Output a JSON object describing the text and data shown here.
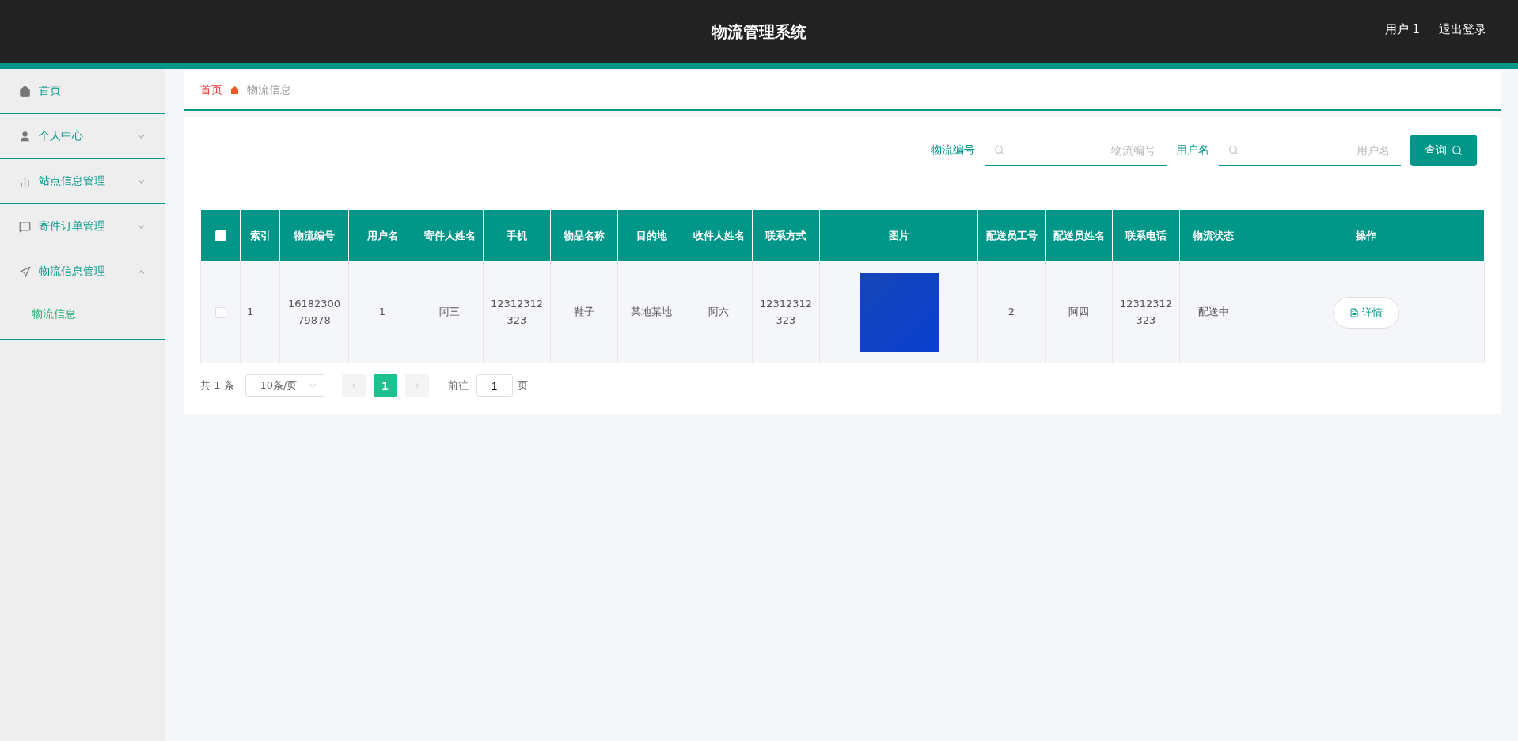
{
  "header": {
    "title": "物流管理系统",
    "user": "用户 1",
    "logout": "退出登录"
  },
  "sidebar": {
    "items": [
      {
        "kind": "link",
        "label": "首页"
      },
      {
        "kind": "group",
        "label": "个人中心",
        "expanded": false
      },
      {
        "kind": "group",
        "label": "站点信息管理",
        "expanded": false
      },
      {
        "kind": "group",
        "label": "寄件订单管理",
        "expanded": false
      },
      {
        "kind": "group",
        "label": "物流信息管理",
        "expanded": true,
        "children": [
          {
            "label": "物流信息",
            "selected": true
          }
        ]
      }
    ]
  },
  "breadcrumb": [
    "首页",
    "物流信息"
  ],
  "search": {
    "fields": [
      {
        "label": "物流编号",
        "placeholder": "物流编号"
      },
      {
        "label": "用户名",
        "placeholder": "用户名"
      }
    ],
    "button": "查询"
  },
  "table": {
    "header_checked": false,
    "columns": [
      "索引",
      "物流编号",
      "用户名",
      "寄件人姓名",
      "手机",
      "物品名称",
      "目的地",
      "收件人姓名",
      "联系方式",
      "图片",
      "配送员工号",
      "配送员姓名",
      "联系电话",
      "物流状态",
      "操作"
    ],
    "rows": [
      {
        "checked": false,
        "cells": [
          "1",
          "1618230079878",
          "1",
          "阿三",
          "12312312323",
          "鞋子",
          "某地某地",
          "阿六",
          "12312312323",
          null,
          "2",
          "阿四",
          "12312312323",
          "配送中"
        ],
        "action": "详情"
      }
    ]
  },
  "pagination": {
    "total": "共 1 条",
    "page_size": "10条/页",
    "pages": [
      {
        "label": "1",
        "selected": true
      }
    ],
    "goto_label": "前往",
    "goto_value": "1",
    "page_suffix": "页"
  }
}
